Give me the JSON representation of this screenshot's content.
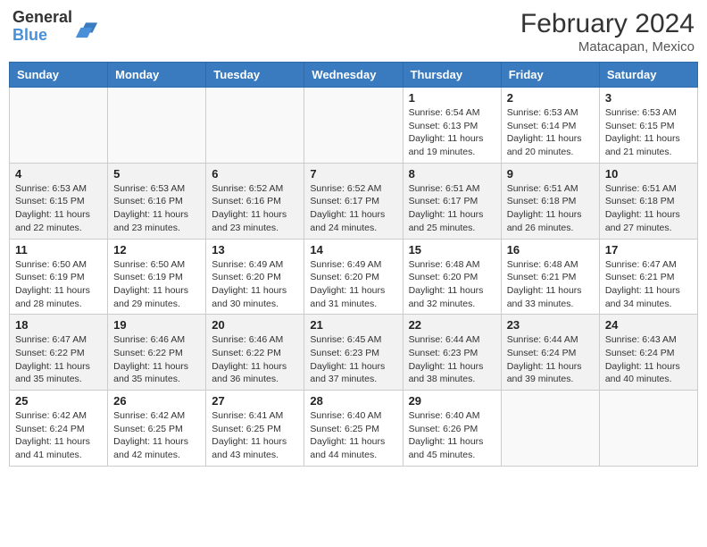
{
  "header": {
    "logo_general": "General",
    "logo_blue": "Blue",
    "main_title": "February 2024",
    "subtitle": "Matacapan, Mexico"
  },
  "calendar": {
    "days_of_week": [
      "Sunday",
      "Monday",
      "Tuesday",
      "Wednesday",
      "Thursday",
      "Friday",
      "Saturday"
    ],
    "weeks": [
      [
        {
          "day": "",
          "info": ""
        },
        {
          "day": "",
          "info": ""
        },
        {
          "day": "",
          "info": ""
        },
        {
          "day": "",
          "info": ""
        },
        {
          "day": "1",
          "info": "Sunrise: 6:54 AM\nSunset: 6:13 PM\nDaylight: 11 hours and 19 minutes."
        },
        {
          "day": "2",
          "info": "Sunrise: 6:53 AM\nSunset: 6:14 PM\nDaylight: 11 hours and 20 minutes."
        },
        {
          "day": "3",
          "info": "Sunrise: 6:53 AM\nSunset: 6:15 PM\nDaylight: 11 hours and 21 minutes."
        }
      ],
      [
        {
          "day": "4",
          "info": "Sunrise: 6:53 AM\nSunset: 6:15 PM\nDaylight: 11 hours and 22 minutes."
        },
        {
          "day": "5",
          "info": "Sunrise: 6:53 AM\nSunset: 6:16 PM\nDaylight: 11 hours and 23 minutes."
        },
        {
          "day": "6",
          "info": "Sunrise: 6:52 AM\nSunset: 6:16 PM\nDaylight: 11 hours and 23 minutes."
        },
        {
          "day": "7",
          "info": "Sunrise: 6:52 AM\nSunset: 6:17 PM\nDaylight: 11 hours and 24 minutes."
        },
        {
          "day": "8",
          "info": "Sunrise: 6:51 AM\nSunset: 6:17 PM\nDaylight: 11 hours and 25 minutes."
        },
        {
          "day": "9",
          "info": "Sunrise: 6:51 AM\nSunset: 6:18 PM\nDaylight: 11 hours and 26 minutes."
        },
        {
          "day": "10",
          "info": "Sunrise: 6:51 AM\nSunset: 6:18 PM\nDaylight: 11 hours and 27 minutes."
        }
      ],
      [
        {
          "day": "11",
          "info": "Sunrise: 6:50 AM\nSunset: 6:19 PM\nDaylight: 11 hours and 28 minutes."
        },
        {
          "day": "12",
          "info": "Sunrise: 6:50 AM\nSunset: 6:19 PM\nDaylight: 11 hours and 29 minutes."
        },
        {
          "day": "13",
          "info": "Sunrise: 6:49 AM\nSunset: 6:20 PM\nDaylight: 11 hours and 30 minutes."
        },
        {
          "day": "14",
          "info": "Sunrise: 6:49 AM\nSunset: 6:20 PM\nDaylight: 11 hours and 31 minutes."
        },
        {
          "day": "15",
          "info": "Sunrise: 6:48 AM\nSunset: 6:20 PM\nDaylight: 11 hours and 32 minutes."
        },
        {
          "day": "16",
          "info": "Sunrise: 6:48 AM\nSunset: 6:21 PM\nDaylight: 11 hours and 33 minutes."
        },
        {
          "day": "17",
          "info": "Sunrise: 6:47 AM\nSunset: 6:21 PM\nDaylight: 11 hours and 34 minutes."
        }
      ],
      [
        {
          "day": "18",
          "info": "Sunrise: 6:47 AM\nSunset: 6:22 PM\nDaylight: 11 hours and 35 minutes."
        },
        {
          "day": "19",
          "info": "Sunrise: 6:46 AM\nSunset: 6:22 PM\nDaylight: 11 hours and 35 minutes."
        },
        {
          "day": "20",
          "info": "Sunrise: 6:46 AM\nSunset: 6:22 PM\nDaylight: 11 hours and 36 minutes."
        },
        {
          "day": "21",
          "info": "Sunrise: 6:45 AM\nSunset: 6:23 PM\nDaylight: 11 hours and 37 minutes."
        },
        {
          "day": "22",
          "info": "Sunrise: 6:44 AM\nSunset: 6:23 PM\nDaylight: 11 hours and 38 minutes."
        },
        {
          "day": "23",
          "info": "Sunrise: 6:44 AM\nSunset: 6:24 PM\nDaylight: 11 hours and 39 minutes."
        },
        {
          "day": "24",
          "info": "Sunrise: 6:43 AM\nSunset: 6:24 PM\nDaylight: 11 hours and 40 minutes."
        }
      ],
      [
        {
          "day": "25",
          "info": "Sunrise: 6:42 AM\nSunset: 6:24 PM\nDaylight: 11 hours and 41 minutes."
        },
        {
          "day": "26",
          "info": "Sunrise: 6:42 AM\nSunset: 6:25 PM\nDaylight: 11 hours and 42 minutes."
        },
        {
          "day": "27",
          "info": "Sunrise: 6:41 AM\nSunset: 6:25 PM\nDaylight: 11 hours and 43 minutes."
        },
        {
          "day": "28",
          "info": "Sunrise: 6:40 AM\nSunset: 6:25 PM\nDaylight: 11 hours and 44 minutes."
        },
        {
          "day": "29",
          "info": "Sunrise: 6:40 AM\nSunset: 6:26 PM\nDaylight: 11 hours and 45 minutes."
        },
        {
          "day": "",
          "info": ""
        },
        {
          "day": "",
          "info": ""
        }
      ]
    ]
  }
}
